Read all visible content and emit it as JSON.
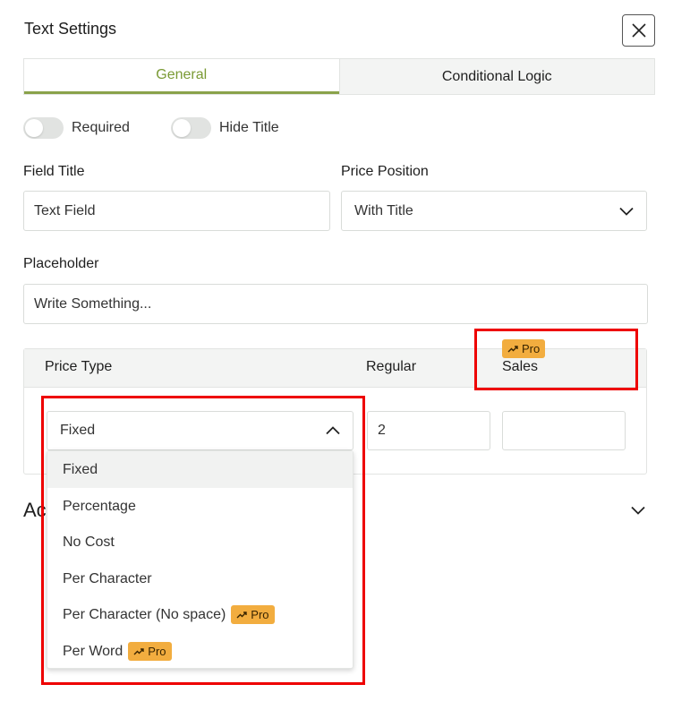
{
  "dialog": {
    "title": "Text Settings",
    "close_icon": "close-icon"
  },
  "tabs": [
    {
      "label": "General",
      "active": true
    },
    {
      "label": "Conditional Logic",
      "active": false
    }
  ],
  "toggles": {
    "required": {
      "label": "Required",
      "on": false
    },
    "hide_title": {
      "label": "Hide Title",
      "on": false
    }
  },
  "fields": {
    "field_title": {
      "label": "Field Title",
      "value": "Text Field"
    },
    "price_position": {
      "label": "Price Position",
      "value": "With Title"
    },
    "placeholder": {
      "label": "Placeholder",
      "value": "Write Something..."
    }
  },
  "price": {
    "headers": {
      "type": "Price Type",
      "regular": "Regular",
      "sales": "Sales"
    },
    "pro_label": "Pro",
    "type_value": "Fixed",
    "regular_value": "2",
    "sales_value": ""
  },
  "dropdown": {
    "options": [
      {
        "label": "Fixed",
        "selected": true,
        "pro": false
      },
      {
        "label": "Percentage",
        "selected": false,
        "pro": false
      },
      {
        "label": "No Cost",
        "selected": false,
        "pro": false
      },
      {
        "label": "Per Character",
        "selected": false,
        "pro": false
      },
      {
        "label": "Per Character (No space)",
        "selected": false,
        "pro": true
      },
      {
        "label": "Per Word",
        "selected": false,
        "pro": true
      }
    ]
  },
  "accordion": {
    "title_visible": "Ac"
  },
  "colors": {
    "accent": "#8aa24a",
    "pro_badge": "#f2ad3f",
    "highlight_box": "#ee0000"
  }
}
